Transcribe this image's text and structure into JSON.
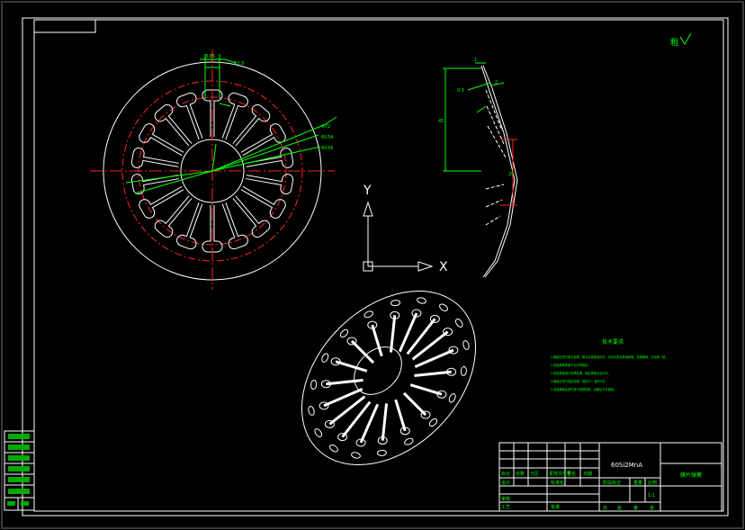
{
  "drawing": {
    "roughness_note": "粗",
    "material": "60Si2MnA",
    "part_name": "膜片弹簧",
    "scale": "1:1"
  },
  "axes_icon": {
    "y_label": "Y",
    "x_label": "X"
  },
  "tech_requirements": {
    "title": "技术要求",
    "items": [
      "1.弹簧应进行喷丸处理，喷丸后表面应均匀，无氧化皮及其他缺陷，锐角倒钝，去毛刺一致。",
      "2.成品弹簧表面不允许有裂纹。",
      "3.成品表面进行发黑处理，保证表面光洁均匀。",
      "4.弹簧应进行强压处理，强压2h，循环5次。",
      "5.成品弹簧应逐件进行载荷检验，合格后方可使用。"
    ]
  },
  "title_block": {
    "labels": [
      "标记",
      "处数",
      "分区",
      "更改文件号",
      "签名",
      "日期"
    ],
    "left_labels": [
      "设计",
      "审核",
      "工艺"
    ],
    "stage_labels": [
      "阶段标记",
      "重量",
      "比例"
    ],
    "standardize": "标准化",
    "approve": "批准",
    "sheet_labels": [
      "共",
      "张",
      "第",
      "张"
    ]
  },
  "dimensions": {
    "front": [
      "3.85",
      "R2.5",
      "Φ72",
      "Φ154",
      "Φ156"
    ],
    "side": [
      "1",
      "2",
      "0.5",
      "45",
      "25"
    ]
  }
}
